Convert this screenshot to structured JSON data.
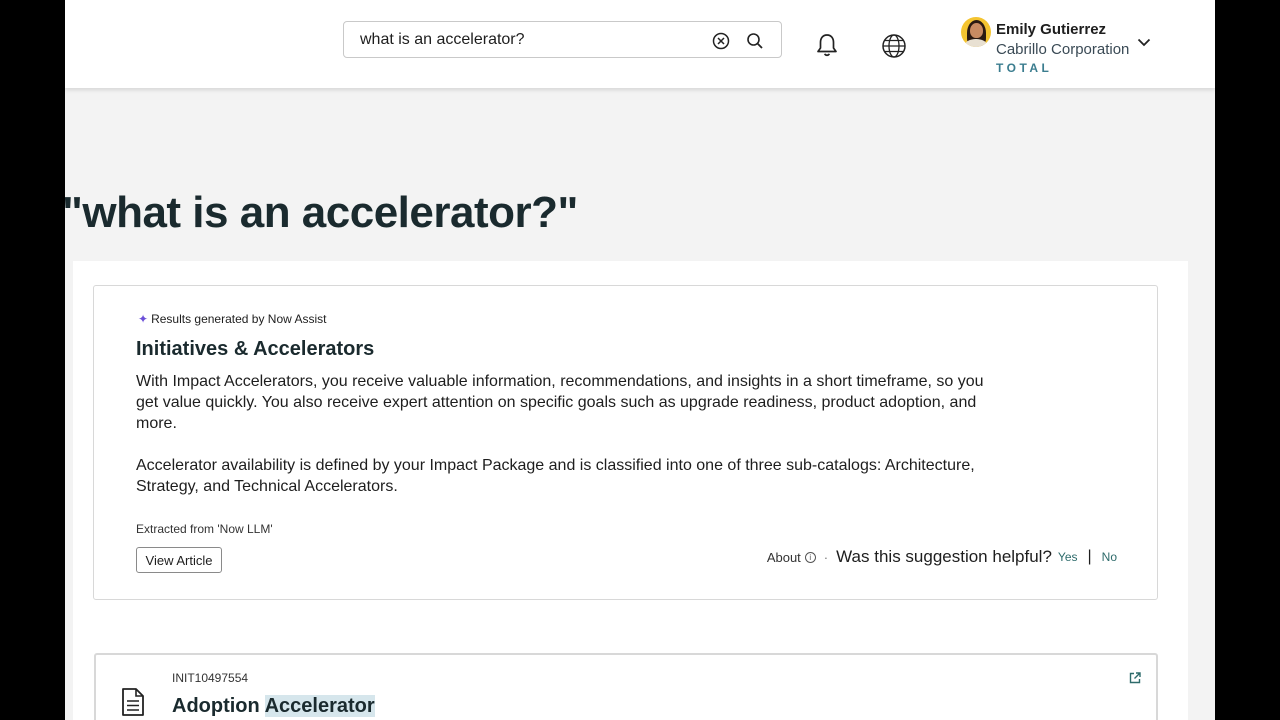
{
  "header": {
    "search": {
      "value": "what is an accelerator?",
      "placeholder": ""
    },
    "icons": {
      "clear": "clear-circle-icon",
      "search": "search-icon",
      "notifications": "bell-icon",
      "language": "globe-icon",
      "user_menu": "chevron-down-icon"
    },
    "user": {
      "name": "Emily Gutierrez",
      "company": "Cabrillo Corporation",
      "brand": "TOTAL"
    }
  },
  "page": {
    "title": "\"what is an accelerator?\""
  },
  "ai_result": {
    "badge": "Results generated by Now Assist",
    "title": "Initiatives & Accelerators",
    "paragraphs": [
      "With Impact Accelerators, you receive valuable information, recommendations, and insights in a short timeframe, so you get value quickly. You also receive expert attention on specific goals such as upgrade readiness, product adoption, and more.",
      "Accelerator availability is defined by your Impact Package and is classified into one of three sub-catalogs: Architecture, Strategy, and Technical Accelerators."
    ],
    "source": "Extracted from 'Now LLM'",
    "view_article_label": "View Article",
    "feedback": {
      "about_label": "About",
      "question": "Was this suggestion helpful?",
      "yes_label": "Yes",
      "no_label": "No"
    }
  },
  "results": [
    {
      "id": "INIT10497554",
      "title_prefix": "Adoption",
      "title_highlight": "Accelerator"
    }
  ],
  "colors": {
    "accent": "#2e6b6b",
    "brand": "#3b7d8f",
    "sparkle": "#6b4fd8",
    "highlight": "#d6e6ec"
  }
}
